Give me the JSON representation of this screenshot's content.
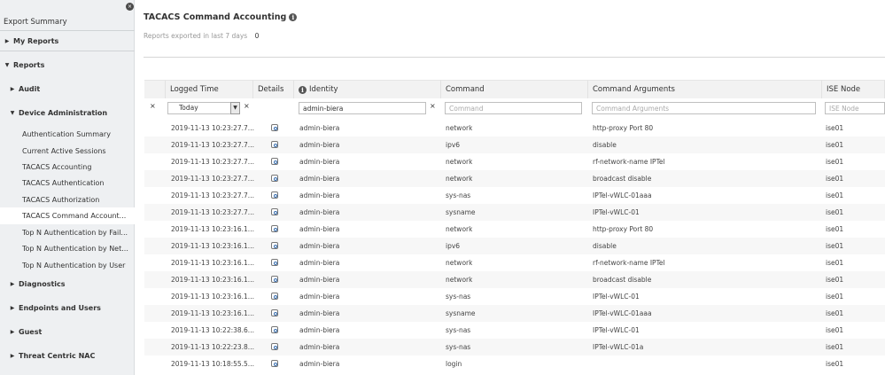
{
  "sidebar": {
    "collapse_label": "×",
    "title": "Export Summary",
    "my_reports": "My Reports",
    "reports": "Reports",
    "audit": "Audit",
    "device_admin": "Device Administration",
    "device_admin_items": [
      "Authentication Summary",
      "Current Active Sessions",
      "TACACS Accounting",
      "TACACS Authentication",
      "TACACS Authorization",
      "TACACS Command Account...",
      "Top N Authentication by Fail...",
      "Top N Authentication by Net...",
      "Top N Authentication by User"
    ],
    "diagnostics": "Diagnostics",
    "endpoints_users": "Endpoints and Users",
    "guest": "Guest",
    "threat_centric": "Threat Centric NAC"
  },
  "page": {
    "title": "TACACS Command Accounting",
    "export_label": "Reports exported in last 7 days",
    "export_count": "0"
  },
  "table": {
    "headers": {
      "logged_time": "Logged Time",
      "details": "Details",
      "identity": "Identity",
      "command": "Command",
      "command_args": "Command Arguments",
      "ise_node": "ISE Node"
    },
    "filters": {
      "clear_all": "×",
      "time_selected": "Today",
      "time_clear": "×",
      "identity_value": "admin-biera",
      "identity_clear": "×",
      "command_placeholder": "Command",
      "command_args_placeholder": "Command Arguments",
      "ise_node_placeholder": "ISE Node"
    },
    "rows": [
      {
        "time": "2019-11-13 10:23:27.7...",
        "identity": "admin-biera",
        "command": "network",
        "args": "http-proxy Port 80",
        "node": "ise01"
      },
      {
        "time": "2019-11-13 10:23:27.7...",
        "identity": "admin-biera",
        "command": "ipv6",
        "args": "disable",
        "node": "ise01"
      },
      {
        "time": "2019-11-13 10:23:27.7...",
        "identity": "admin-biera",
        "command": "network",
        "args": "rf-network-name IPTel",
        "node": "ise01"
      },
      {
        "time": "2019-11-13 10:23:27.7...",
        "identity": "admin-biera",
        "command": "network",
        "args": "broadcast disable",
        "node": "ise01"
      },
      {
        "time": "2019-11-13 10:23:27.7...",
        "identity": "admin-biera",
        "command": "sys-nas",
        "args": "IPTel-vWLC-01aaa",
        "node": "ise01"
      },
      {
        "time": "2019-11-13 10:23:27.7...",
        "identity": "admin-biera",
        "command": "sysname",
        "args": "IPTel-vWLC-01",
        "node": "ise01"
      },
      {
        "time": "2019-11-13 10:23:16.1...",
        "identity": "admin-biera",
        "command": "network",
        "args": "http-proxy Port 80",
        "node": "ise01"
      },
      {
        "time": "2019-11-13 10:23:16.1...",
        "identity": "admin-biera",
        "command": "ipv6",
        "args": "disable",
        "node": "ise01"
      },
      {
        "time": "2019-11-13 10:23:16.1...",
        "identity": "admin-biera",
        "command": "network",
        "args": "rf-network-name IPTel",
        "node": "ise01"
      },
      {
        "time": "2019-11-13 10:23:16.1...",
        "identity": "admin-biera",
        "command": "network",
        "args": "broadcast disable",
        "node": "ise01"
      },
      {
        "time": "2019-11-13 10:23:16.1...",
        "identity": "admin-biera",
        "command": "sys-nas",
        "args": "IPTel-vWLC-01",
        "node": "ise01"
      },
      {
        "time": "2019-11-13 10:23:16.1...",
        "identity": "admin-biera",
        "command": "sysname",
        "args": "IPTel-vWLC-01aaa",
        "node": "ise01"
      },
      {
        "time": "2019-11-13 10:22:38.6...",
        "identity": "admin-biera",
        "command": "sys-nas",
        "args": "IPTel-vWLC-01",
        "node": "ise01"
      },
      {
        "time": "2019-11-13 10:22:23.8...",
        "identity": "admin-biera",
        "command": "sys-nas",
        "args": "IPTel-vWLC-01a",
        "node": "ise01"
      },
      {
        "time": "2019-11-13 10:18:55.5...",
        "identity": "admin-biera",
        "command": "login",
        "args": "",
        "node": "ise01"
      }
    ]
  }
}
